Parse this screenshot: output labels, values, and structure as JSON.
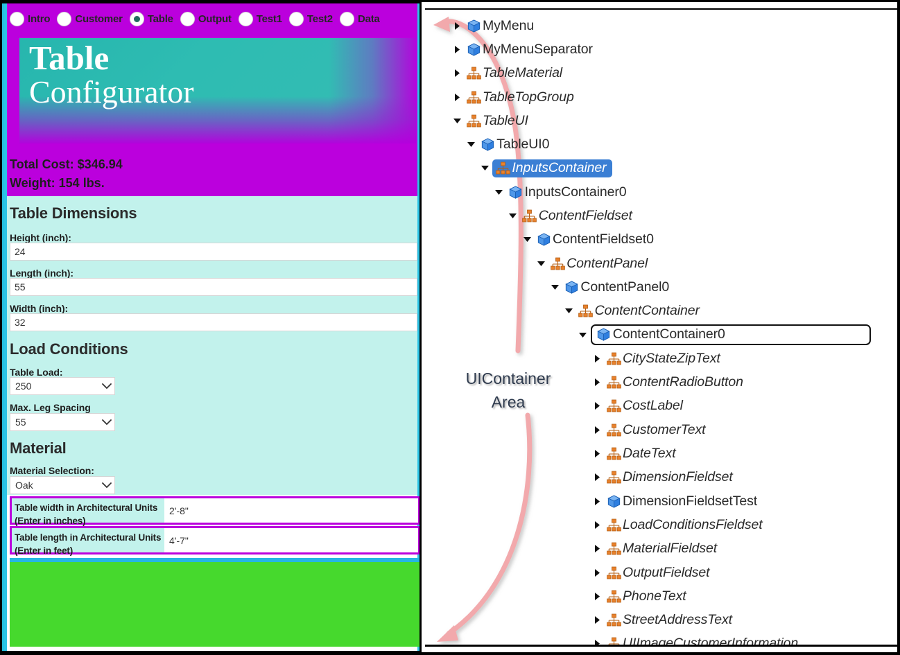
{
  "config_panel": {
    "tabs": [
      {
        "label": "Intro",
        "selected": false
      },
      {
        "label": "Customer",
        "selected": false
      },
      {
        "label": "Table",
        "selected": true
      },
      {
        "label": "Output",
        "selected": false
      },
      {
        "label": "Test1",
        "selected": false
      },
      {
        "label": "Test2",
        "selected": false
      },
      {
        "label": "Data",
        "selected": false
      }
    ],
    "header": {
      "line1": "Table",
      "line2": "Configurator"
    },
    "totals": {
      "cost": "Total Cost: $346.94",
      "weight": "Weight: 154 lbs."
    },
    "sections": {
      "dimensions_title": "Table Dimensions",
      "height_label": "Height (inch):",
      "height_value": "24",
      "length_label": "Length (inch):",
      "length_value": "55",
      "width_label": "Width (inch):",
      "width_value": "32",
      "load_title": "Load Conditions",
      "table_load_label": "Table Load:",
      "table_load_value": "250",
      "leg_spacing_label": "Max. Leg Spacing",
      "leg_spacing_value": "55",
      "material_title": "Material",
      "material_label": "Material Selection:",
      "material_value": "Oak"
    },
    "arch_units": [
      {
        "label": "Table width in Architectural Units (Enter in inches)",
        "value": "2'-8\""
      },
      {
        "label": "Table length in Architectural Units (Enter in feet)",
        "value": "4'-7\""
      }
    ],
    "colors": {
      "magenta": "#bb00dd",
      "aqua": "#c2f2ec",
      "green": "#46d92d",
      "cyan_border": "#25b6e4",
      "teal_header": "#2ebcb2",
      "radio_dot": "#1f6b5e"
    }
  },
  "tree_panel": {
    "annotation": "UIContainer\nArea",
    "arrow_color": "#f2a9ac",
    "selection_color": "#3b7fd4",
    "items": [
      {
        "label": "MyMenu",
        "depth": 0,
        "icon": "cube-icon",
        "expander": "collapsed",
        "italic": false,
        "selected": false,
        "boxed": false
      },
      {
        "label": "MyMenuSeparator",
        "depth": 0,
        "icon": "cube-icon",
        "expander": "collapsed",
        "italic": false,
        "selected": false,
        "boxed": false
      },
      {
        "label": "TableMaterial",
        "depth": 0,
        "icon": "hierarchy-icon",
        "expander": "collapsed",
        "italic": true,
        "selected": false,
        "boxed": false
      },
      {
        "label": "TableTopGroup",
        "depth": 0,
        "icon": "hierarchy-icon",
        "expander": "collapsed",
        "italic": true,
        "selected": false,
        "boxed": false
      },
      {
        "label": "TableUI",
        "depth": 0,
        "icon": "hierarchy-icon",
        "expander": "expanded",
        "italic": true,
        "selected": false,
        "boxed": false
      },
      {
        "label": "TableUI0",
        "depth": 1,
        "icon": "cube-icon",
        "expander": "expanded",
        "italic": false,
        "selected": false,
        "boxed": false
      },
      {
        "label": "InputsContainer",
        "depth": 2,
        "icon": "hierarchy-icon",
        "expander": "expanded",
        "italic": true,
        "selected": true,
        "boxed": false
      },
      {
        "label": "InputsContainer0",
        "depth": 3,
        "icon": "cube-icon",
        "expander": "expanded",
        "italic": false,
        "selected": false,
        "boxed": false
      },
      {
        "label": "ContentFieldset",
        "depth": 4,
        "icon": "hierarchy-icon",
        "expander": "expanded",
        "italic": true,
        "selected": false,
        "boxed": false
      },
      {
        "label": "ContentFieldset0",
        "depth": 5,
        "icon": "cube-icon",
        "expander": "expanded",
        "italic": false,
        "selected": false,
        "boxed": false
      },
      {
        "label": "ContentPanel",
        "depth": 6,
        "icon": "hierarchy-icon",
        "expander": "expanded",
        "italic": true,
        "selected": false,
        "boxed": false
      },
      {
        "label": "ContentPanel0",
        "depth": 7,
        "icon": "cube-icon",
        "expander": "expanded",
        "italic": false,
        "selected": false,
        "boxed": false
      },
      {
        "label": "ContentContainer",
        "depth": 8,
        "icon": "hierarchy-icon",
        "expander": "expanded",
        "italic": true,
        "selected": false,
        "boxed": false
      },
      {
        "label": "ContentContainer0",
        "depth": 9,
        "icon": "cube-icon",
        "expander": "expanded",
        "italic": false,
        "selected": false,
        "boxed": true
      },
      {
        "label": "CityStateZipText",
        "depth": 10,
        "icon": "hierarchy-icon",
        "expander": "collapsed",
        "italic": true,
        "selected": false,
        "boxed": false
      },
      {
        "label": "ContentRadioButton",
        "depth": 10,
        "icon": "hierarchy-icon",
        "expander": "collapsed",
        "italic": true,
        "selected": false,
        "boxed": false
      },
      {
        "label": "CostLabel",
        "depth": 10,
        "icon": "hierarchy-icon",
        "expander": "collapsed",
        "italic": true,
        "selected": false,
        "boxed": false
      },
      {
        "label": "CustomerText",
        "depth": 10,
        "icon": "hierarchy-icon",
        "expander": "collapsed",
        "italic": true,
        "selected": false,
        "boxed": false
      },
      {
        "label": "DateText",
        "depth": 10,
        "icon": "hierarchy-icon",
        "expander": "collapsed",
        "italic": true,
        "selected": false,
        "boxed": false
      },
      {
        "label": "DimensionFieldset",
        "depth": 10,
        "icon": "hierarchy-icon",
        "expander": "collapsed",
        "italic": true,
        "selected": false,
        "boxed": false
      },
      {
        "label": "DimensionFieldsetTest",
        "depth": 10,
        "icon": "cube-icon",
        "expander": "collapsed",
        "italic": false,
        "selected": false,
        "boxed": false
      },
      {
        "label": "LoadConditionsFieldset",
        "depth": 10,
        "icon": "hierarchy-icon",
        "expander": "collapsed",
        "italic": true,
        "selected": false,
        "boxed": false
      },
      {
        "label": "MaterialFieldset",
        "depth": 10,
        "icon": "hierarchy-icon",
        "expander": "collapsed",
        "italic": true,
        "selected": false,
        "boxed": false
      },
      {
        "label": "OutputFieldset",
        "depth": 10,
        "icon": "hierarchy-icon",
        "expander": "collapsed",
        "italic": true,
        "selected": false,
        "boxed": false
      },
      {
        "label": "PhoneText",
        "depth": 10,
        "icon": "hierarchy-icon",
        "expander": "collapsed",
        "italic": true,
        "selected": false,
        "boxed": false
      },
      {
        "label": "StreetAddressText",
        "depth": 10,
        "icon": "hierarchy-icon",
        "expander": "collapsed",
        "italic": true,
        "selected": false,
        "boxed": false
      },
      {
        "label": "UIImageCustomerInformation",
        "depth": 10,
        "icon": "hierarchy-icon",
        "expander": "collapsed",
        "italic": true,
        "selected": false,
        "boxed": false
      }
    ],
    "scrollbar": {
      "up_icon": "scroll-up-icon",
      "down_icon": "scroll-down-icon"
    }
  }
}
